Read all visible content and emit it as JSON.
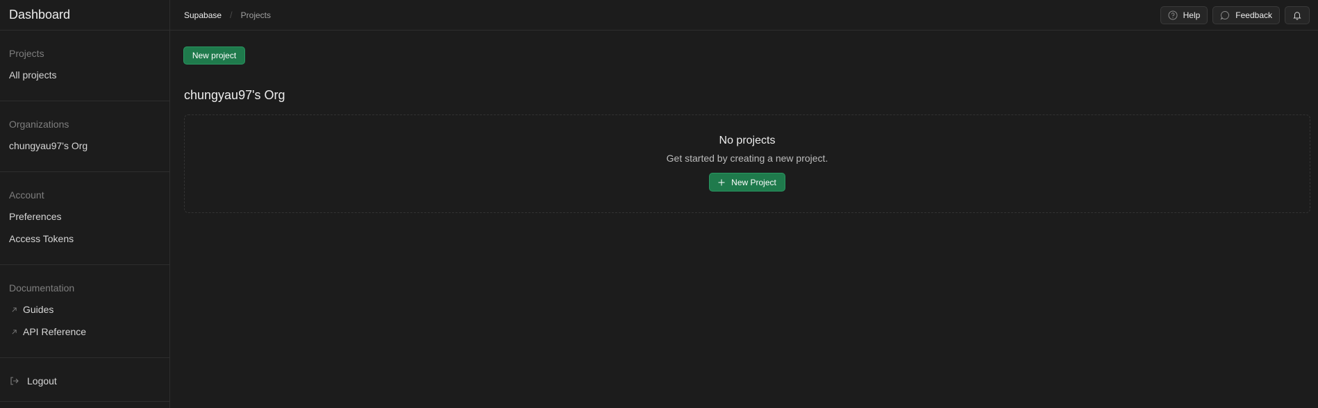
{
  "sidebar": {
    "title": "Dashboard",
    "sections": {
      "projects": {
        "title": "Projects",
        "items": [
          "All projects"
        ]
      },
      "organizations": {
        "title": "Organizations",
        "items": [
          "chungyau97's Org"
        ]
      },
      "account": {
        "title": "Account",
        "items": [
          "Preferences",
          "Access Tokens"
        ]
      },
      "documentation": {
        "title": "Documentation",
        "items": [
          "Guides",
          "API Reference"
        ]
      }
    },
    "logout_label": "Logout"
  },
  "header": {
    "breadcrumb": {
      "root": "Supabase",
      "separator": "/",
      "current": "Projects"
    },
    "help_label": "Help",
    "feedback_label": "Feedback"
  },
  "main": {
    "new_project_label": "New project",
    "org_name": "chungyau97's Org",
    "empty_state": {
      "title": "No projects",
      "description": "Get started by creating a new project.",
      "button_label": "New Project"
    }
  },
  "colors": {
    "background": "#1c1c1c",
    "border": "#2e2e2e",
    "brand_green": "#1f7a4c",
    "text_primary": "#ededed",
    "text_muted": "#7e7e7e"
  },
  "icons": {
    "help": "help-circle-icon",
    "feedback": "message-circle-icon",
    "notifications": "bell-icon",
    "external": "arrow-up-right-icon",
    "logout": "log-out-icon",
    "add": "plus-icon"
  }
}
